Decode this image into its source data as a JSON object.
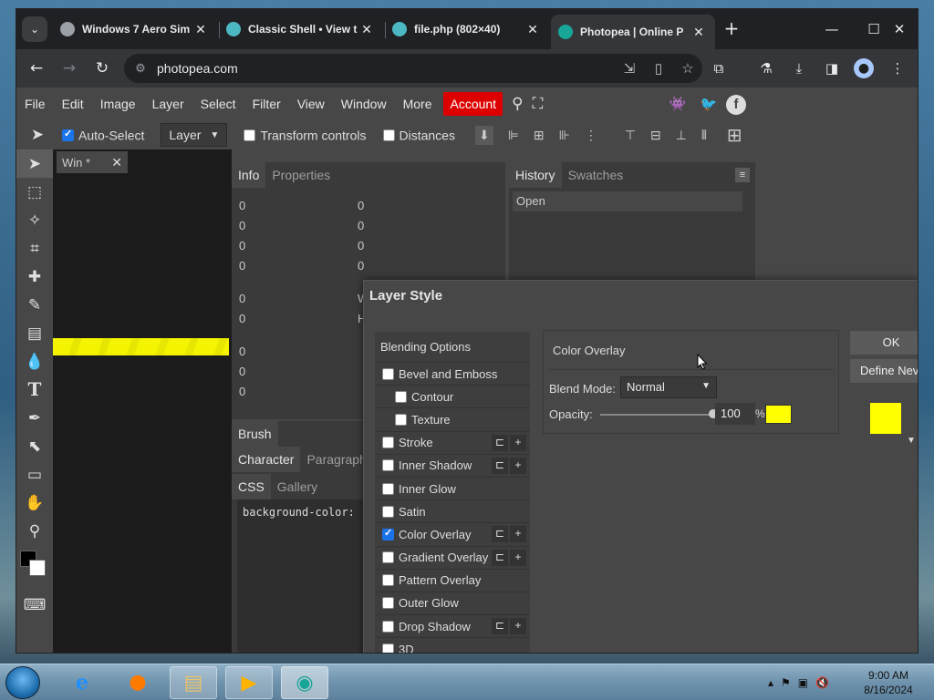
{
  "browser": {
    "tabs": [
      {
        "title": "Windows 7 Aero Sim",
        "favicon_color": "#9aa0a6"
      },
      {
        "title": "Classic Shell • View t",
        "favicon_color": "#4cb8c4"
      },
      {
        "title": "file.php (802×40)",
        "favicon_color": "#4cb8c4"
      },
      {
        "title": "Photopea | Online P",
        "favicon_color": "#17a697"
      }
    ],
    "active_tab_index": 3,
    "url": "photopea.com"
  },
  "photopea": {
    "menu": [
      "File",
      "Edit",
      "Image",
      "Layer",
      "Select",
      "Filter",
      "View",
      "Window",
      "More"
    ],
    "account_label": "Account",
    "options": {
      "auto_select_label": "Auto-Select",
      "auto_select_checked": true,
      "layer_select_value": "Layer",
      "transform_label": "Transform controls",
      "distances_label": "Distances"
    },
    "doc_tab": "Win *",
    "info_panel": {
      "tabs": [
        "Info",
        "Properties"
      ],
      "rows": [
        {
          "a": "0",
          "b": "0"
        },
        {
          "a": "0",
          "b": "0"
        },
        {
          "a": "0",
          "b": "0"
        },
        {
          "a": "0",
          "b": "0"
        },
        {
          "a": "0",
          "b": "W"
        },
        {
          "a": "0",
          "b": "H"
        },
        {
          "a": "0",
          "b": ""
        },
        {
          "a": "0",
          "b": ""
        },
        {
          "a": "0",
          "b": ""
        }
      ],
      "brush_tab": "Brush",
      "char_tabs": [
        "Character",
        "Paragraph"
      ],
      "css_tabs": [
        "CSS",
        "Gallery"
      ],
      "css_text": "background-color:"
    },
    "history_panel": {
      "tabs": [
        "History",
        "Swatches"
      ],
      "items": [
        "Open"
      ]
    }
  },
  "dialog": {
    "title": "Layer Style",
    "styles": [
      {
        "label": "Blending Options",
        "checkbox": false,
        "checked": false,
        "indent": false,
        "buttons": false,
        "head": true
      },
      {
        "label": "Bevel and Emboss",
        "checkbox": true,
        "checked": false,
        "indent": false,
        "buttons": false
      },
      {
        "label": "Contour",
        "checkbox": true,
        "checked": false,
        "indent": true,
        "buttons": false
      },
      {
        "label": "Texture",
        "checkbox": true,
        "checked": false,
        "indent": true,
        "buttons": false
      },
      {
        "label": "Stroke",
        "checkbox": true,
        "checked": false,
        "indent": false,
        "buttons": true
      },
      {
        "label": "Inner Shadow",
        "checkbox": true,
        "checked": false,
        "indent": false,
        "buttons": true
      },
      {
        "label": "Inner Glow",
        "checkbox": true,
        "checked": false,
        "indent": false,
        "buttons": false
      },
      {
        "label": "Satin",
        "checkbox": true,
        "checked": false,
        "indent": false,
        "buttons": false
      },
      {
        "label": "Color Overlay",
        "checkbox": true,
        "checked": true,
        "indent": false,
        "buttons": true
      },
      {
        "label": "Gradient Overlay",
        "checkbox": true,
        "checked": false,
        "indent": false,
        "buttons": true
      },
      {
        "label": "Pattern Overlay",
        "checkbox": true,
        "checked": false,
        "indent": false,
        "buttons": false
      },
      {
        "label": "Outer Glow",
        "checkbox": true,
        "checked": false,
        "indent": false,
        "buttons": false
      },
      {
        "label": "Drop Shadow",
        "checkbox": true,
        "checked": false,
        "indent": false,
        "buttons": true
      },
      {
        "label": "3D",
        "checkbox": true,
        "checked": false,
        "indent": false,
        "buttons": false
      }
    ],
    "color_overlay": {
      "title": "Color Overlay",
      "blend_mode_label": "Blend Mode:",
      "blend_mode_value": "Normal",
      "opacity_label": "Opacity:",
      "opacity_value": "100",
      "opacity_unit": "%",
      "color": "#ffff00"
    },
    "ok_label": "OK",
    "define_new_label": "Define Nev"
  },
  "taskbar": {
    "time": "9:00 AM",
    "date": "8/16/2024"
  }
}
